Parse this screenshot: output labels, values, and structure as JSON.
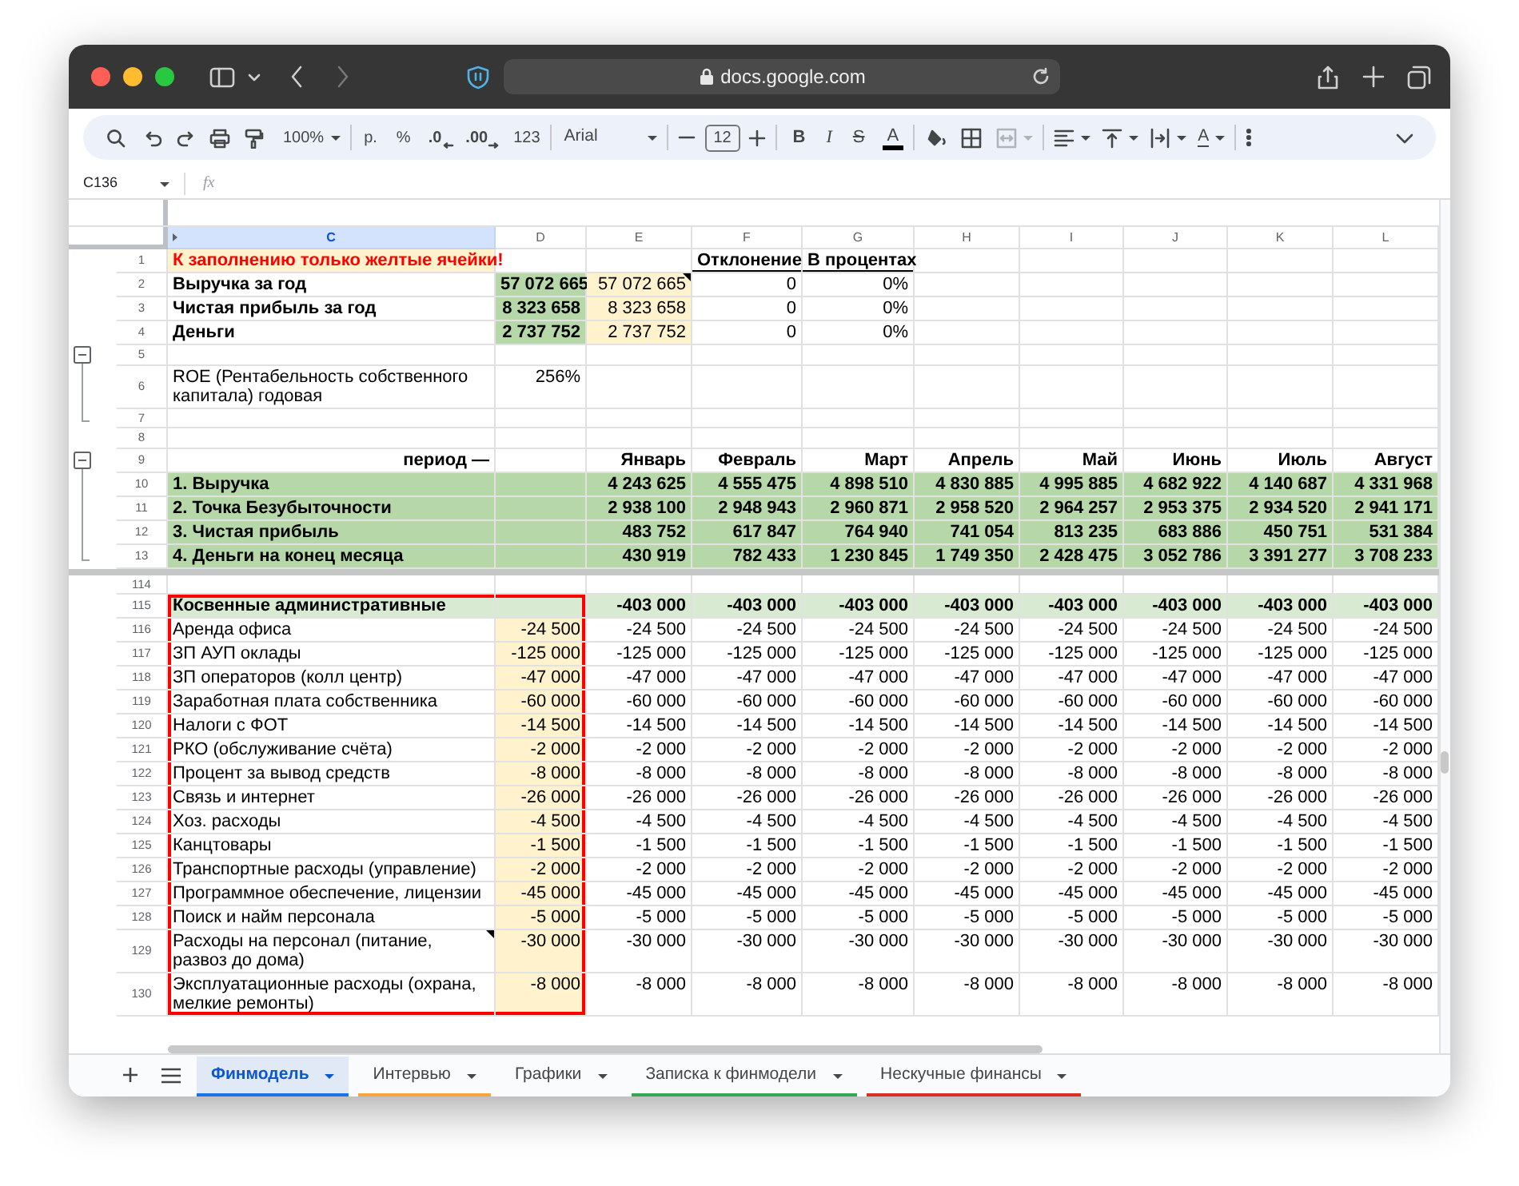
{
  "browser": {
    "url": "docs.google.com"
  },
  "toolbar": {
    "zoom": "100%",
    "currency": "р.",
    "percent": "%",
    "decrease_decimals": ".0",
    "increase_decimals": ".00",
    "number_format": "123",
    "font": "Arial",
    "font_size": "12",
    "bold": "B",
    "italic": "I",
    "strikethrough": "S",
    "text_color": "A",
    "text_rotation": "A"
  },
  "formula_bar": {
    "cell_reference": "C136",
    "function_label": "fx"
  },
  "columns": [
    {
      "label": "C",
      "selected": true
    },
    {
      "label": "D",
      "selected": false
    },
    {
      "label": "E",
      "selected": false
    },
    {
      "label": "F",
      "selected": false
    },
    {
      "label": "G",
      "selected": false
    },
    {
      "label": "H",
      "selected": false
    },
    {
      "label": "I",
      "selected": false
    },
    {
      "label": "J",
      "selected": false
    },
    {
      "label": "K",
      "selected": false
    },
    {
      "label": "L",
      "selected": false
    }
  ],
  "frozen_rows": [
    {
      "number": "1",
      "kind": "note",
      "cells": [
        "К заполнению только желтые ячейки!",
        null,
        null,
        "Отклонение",
        "В процентах"
      ]
    },
    {
      "number": "2",
      "kind": "summary",
      "cells": [
        "Выручка за год",
        "57 072 665",
        {
          "text": "57 072 665",
          "comment": true
        },
        "0",
        "0%"
      ]
    },
    {
      "number": "3",
      "kind": "summary",
      "cells": [
        "Чистая прибыль за год",
        "8 323 658",
        "8 323 658",
        "0",
        "0%"
      ]
    },
    {
      "number": "4",
      "kind": "summary",
      "cells": [
        "Деньги",
        "2 737 752",
        "2 737 752",
        "0",
        "0%"
      ]
    },
    {
      "number": "5",
      "kind": "plain",
      "group_toggle": {
        "expanded": true
      },
      "cells": []
    },
    {
      "number": "6",
      "kind": "plain",
      "in_group": true,
      "cells": [
        "ROE (Рентабельность собственного капитала) годовая",
        "256%"
      ]
    },
    {
      "number": "7",
      "kind": "plain",
      "in_group": true,
      "cells": []
    },
    {
      "number": "8",
      "kind": "plain",
      "cells": []
    },
    {
      "number": "9",
      "kind": "period",
      "group_toggle": {
        "expanded": true
      },
      "cells": [
        "период —",
        null,
        "Январь",
        "Февраль",
        "Март",
        "Апрель",
        "Май",
        "Июнь",
        "Июль",
        "Август"
      ]
    },
    {
      "number": "10",
      "kind": "total",
      "in_group": true,
      "cells": [
        "1. Выручка",
        null,
        "4 243 625",
        "4 555 475",
        "4 898 510",
        "4 830 885",
        "4 995 885",
        "4 682 922",
        "4 140 687",
        "4 331 968"
      ]
    },
    {
      "number": "11",
      "kind": "total",
      "in_group": true,
      "cells": [
        "2. Точка Безубыточности",
        null,
        "2 938 100",
        "2 948 943",
        "2 960 871",
        "2 958 520",
        "2 964 257",
        "2 953 375",
        "2 934 520",
        "2 941 171"
      ]
    },
    {
      "number": "12",
      "kind": "total",
      "in_group": true,
      "cells": [
        "3. Чистая прибыль",
        null,
        "483 752",
        "617 847",
        "764 940",
        "741 054",
        "813 235",
        "683 886",
        "450 751",
        "531 384"
      ]
    },
    {
      "number": "13",
      "kind": "total",
      "in_group": true,
      "cells": [
        "4. Деньги на конец месяца",
        null,
        "430 919",
        "782 433",
        "1 230 845",
        "1 749 350",
        "2 428 475",
        "3 052 786",
        "3 391 277",
        "3 708 233"
      ]
    }
  ],
  "rows": [
    {
      "number": "114",
      "kind": "plain",
      "cells": []
    },
    {
      "number": "115",
      "kind": "group",
      "outlined": true,
      "cells": [
        "Косвенные административные",
        null,
        "-403 000",
        "-403 000",
        "-403 000",
        "-403 000",
        "-403 000",
        "-403 000",
        "-403 000",
        "-403 000"
      ]
    },
    {
      "number": "116",
      "kind": "expense",
      "outlined": true,
      "cells": [
        "Аренда офиса",
        "-24 500",
        "-24 500",
        "-24 500",
        "-24 500",
        "-24 500",
        "-24 500",
        "-24 500",
        "-24 500",
        "-24 500"
      ]
    },
    {
      "number": "117",
      "kind": "expense",
      "outlined": true,
      "cells": [
        "ЗП АУП оклады",
        "-125 000",
        "-125 000",
        "-125 000",
        "-125 000",
        "-125 000",
        "-125 000",
        "-125 000",
        "-125 000",
        "-125 000"
      ]
    },
    {
      "number": "118",
      "kind": "expense",
      "outlined": true,
      "cells": [
        "ЗП операторов (колл центр)",
        "-47 000",
        "-47 000",
        "-47 000",
        "-47 000",
        "-47 000",
        "-47 000",
        "-47 000",
        "-47 000",
        "-47 000"
      ]
    },
    {
      "number": "119",
      "kind": "expense",
      "outlined": true,
      "cells": [
        "Заработная плата собственника",
        "-60 000",
        "-60 000",
        "-60 000",
        "-60 000",
        "-60 000",
        "-60 000",
        "-60 000",
        "-60 000",
        "-60 000"
      ]
    },
    {
      "number": "120",
      "kind": "expense",
      "outlined": true,
      "cells": [
        "Налоги с ФОТ",
        "-14 500",
        "-14 500",
        "-14 500",
        "-14 500",
        "-14 500",
        "-14 500",
        "-14 500",
        "-14 500",
        "-14 500"
      ]
    },
    {
      "number": "121",
      "kind": "expense",
      "outlined": true,
      "cells": [
        "РКО (обслуживание счёта)",
        "-2 000",
        "-2 000",
        "-2 000",
        "-2 000",
        "-2 000",
        "-2 000",
        "-2 000",
        "-2 000",
        "-2 000"
      ]
    },
    {
      "number": "122",
      "kind": "expense",
      "outlined": true,
      "cells": [
        "Процент за вывод средств",
        "-8 000",
        "-8 000",
        "-8 000",
        "-8 000",
        "-8 000",
        "-8 000",
        "-8 000",
        "-8 000",
        "-8 000"
      ]
    },
    {
      "number": "123",
      "kind": "expense",
      "outlined": true,
      "cells": [
        "Связь и интернет",
        "-26 000",
        "-26 000",
        "-26 000",
        "-26 000",
        "-26 000",
        "-26 000",
        "-26 000",
        "-26 000",
        "-26 000"
      ]
    },
    {
      "number": "124",
      "kind": "expense",
      "outlined": true,
      "cells": [
        "Хоз. расходы",
        "-4 500",
        "-4 500",
        "-4 500",
        "-4 500",
        "-4 500",
        "-4 500",
        "-4 500",
        "-4 500",
        "-4 500"
      ]
    },
    {
      "number": "125",
      "kind": "expense",
      "outlined": true,
      "cells": [
        "Канцтовары",
        "-1 500",
        "-1 500",
        "-1 500",
        "-1 500",
        "-1 500",
        "-1 500",
        "-1 500",
        "-1 500",
        "-1 500"
      ]
    },
    {
      "number": "126",
      "kind": "expense",
      "outlined": true,
      "cells": [
        "Транспортные расходы (управление)",
        "-2 000",
        "-2 000",
        "-2 000",
        "-2 000",
        "-2 000",
        "-2 000",
        "-2 000",
        "-2 000",
        "-2 000"
      ]
    },
    {
      "number": "127",
      "kind": "expense",
      "outlined": true,
      "cells": [
        "Программное обеспечение, лицензии",
        "-45 000",
        "-45 000",
        "-45 000",
        "-45 000",
        "-45 000",
        "-45 000",
        "-45 000",
        "-45 000",
        "-45 000"
      ]
    },
    {
      "number": "128",
      "kind": "expense",
      "outlined": true,
      "cells": [
        "Поиск и найм персонала",
        "-5 000",
        "-5 000",
        "-5 000",
        "-5 000",
        "-5 000",
        "-5 000",
        "-5 000",
        "-5 000",
        "-5 000"
      ]
    },
    {
      "number": "129",
      "kind": "expense",
      "outlined": true,
      "cells": [
        {
          "text": "Расходы на персонал (питание, развоз до дома)",
          "comment": true
        },
        "-30 000",
        "-30 000",
        "-30 000",
        "-30 000",
        "-30 000",
        "-30 000",
        "-30 000",
        "-30 000",
        "-30 000"
      ]
    },
    {
      "number": "130",
      "kind": "expense",
      "outlined": true,
      "cells": [
        "Эксплуатационные расходы (охрана, мелкие ремонты)",
        "-8 000",
        "-8 000",
        "-8 000",
        "-8 000",
        "-8 000",
        "-8 000",
        "-8 000",
        "-8 000",
        "-8 000"
      ]
    }
  ],
  "sheet_tabs": [
    {
      "label": "Финмодель",
      "selected": true,
      "color": "#1a73e8"
    },
    {
      "label": "Интервью",
      "selected": false,
      "color": "#f6a53c"
    },
    {
      "label": "Графики",
      "selected": false
    },
    {
      "label": "Записка к финмодели",
      "selected": false,
      "color": "#34a853"
    },
    {
      "label": "Нескучные финансы",
      "selected": false,
      "color": "#d93025"
    }
  ]
}
